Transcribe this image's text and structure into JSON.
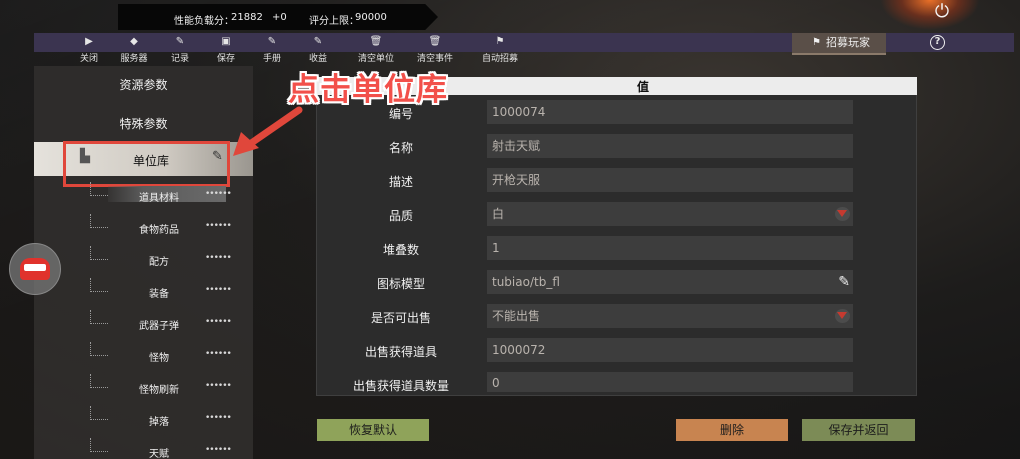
{
  "stats": {
    "perf_label": "性能负载分：",
    "perf_value": "21882",
    "perf_delta": "+0",
    "rating_label": "评分上限：",
    "rating_value": "90000"
  },
  "toolbar": {
    "items": [
      {
        "label": "关闭",
        "icon": "play-icon"
      },
      {
        "label": "服务器",
        "icon": "cube-icon"
      },
      {
        "label": "记录",
        "icon": "note-icon"
      },
      {
        "label": "保存",
        "icon": "save-icon"
      },
      {
        "label": "手册",
        "icon": "book-icon"
      },
      {
        "label": "收益",
        "icon": "earnings-icon"
      },
      {
        "label": "清空单位",
        "icon": "trash-icon"
      },
      {
        "label": "清空事件",
        "icon": "trash-icon"
      },
      {
        "label": "自动招募",
        "icon": "flag-icon"
      }
    ],
    "recruit_label": "招募玩家",
    "help": "?"
  },
  "sidebar": {
    "resource_params": "资源参数",
    "special_params": "特殊参数",
    "unit_library": "单位库",
    "sub_items": [
      "道具材料",
      "食物药品",
      "配方",
      "装备",
      "武器子弹",
      "怪物",
      "怪物刷新",
      "掉落",
      "天赋"
    ],
    "dots": "••••••"
  },
  "annotation": "点击单位库",
  "panel": {
    "value_header": "值",
    "rows": [
      {
        "label": "编号",
        "value": "1000074",
        "kind": "text"
      },
      {
        "label": "名称",
        "value": "射击天赋",
        "kind": "text"
      },
      {
        "label": "描述",
        "value": "开枪天服",
        "kind": "text"
      },
      {
        "label": "品质",
        "value": "白",
        "kind": "dropdown"
      },
      {
        "label": "堆叠数",
        "value": "1",
        "kind": "text"
      },
      {
        "label": "图标模型",
        "value": "tubiao/tb_fl",
        "kind": "edit"
      },
      {
        "label": "是否可出售",
        "value": "不能出售",
        "kind": "dropdown"
      },
      {
        "label": "出售获得道具",
        "value": "1000072",
        "kind": "text"
      },
      {
        "label": "出售获得道具数量",
        "value": "0",
        "kind": "text"
      }
    ]
  },
  "buttons": {
    "restore_default": "恢复默认",
    "delete": "删除",
    "save_return": "保存并返回"
  },
  "colors": {
    "toolbar_bg": "#3b3450",
    "annotation": "#f2504a",
    "restore_btn": "#8fa35a",
    "delete_btn": "#c88450",
    "save_btn": "#7c8b56"
  }
}
